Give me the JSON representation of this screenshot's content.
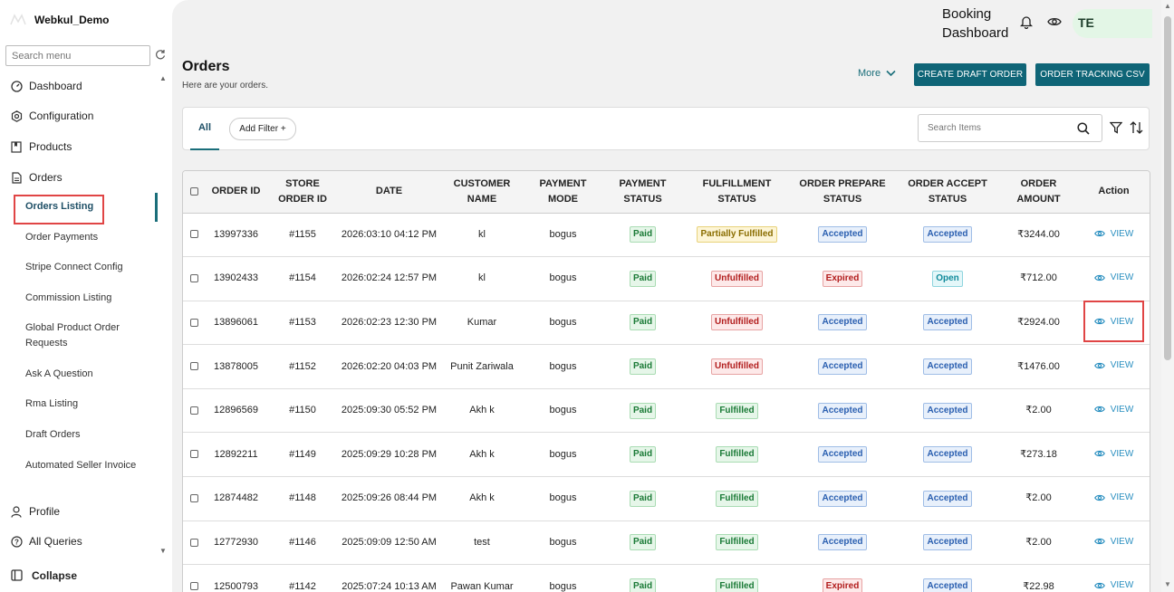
{
  "brand": {
    "name": "Webkul_Demo"
  },
  "sidebar": {
    "search_placeholder": "Search menu",
    "items": [
      {
        "label": "Dashboard",
        "icon": "dashboard-icon"
      },
      {
        "label": "Configuration",
        "icon": "settings-icon"
      },
      {
        "label": "Products",
        "icon": "bookmark-icon"
      },
      {
        "label": "Orders",
        "icon": "file-icon"
      }
    ],
    "subitems": [
      "Orders Listing",
      "Order Payments",
      "Stripe Connect Config",
      "Commission Listing",
      "Global Product Order Requests",
      "Ask A Question",
      "Rma Listing",
      "Draft Orders",
      "Automated Seller Invoice"
    ],
    "bottom_items": [
      {
        "label": "Profile",
        "icon": "user-icon"
      },
      {
        "label": "All Queries",
        "icon": "help-icon"
      }
    ],
    "collapse_label": "Collapse"
  },
  "topbar": {
    "title": "Booking Dashboard",
    "avatar_initials": "TE"
  },
  "page": {
    "title": "Orders",
    "subtitle": "Here are your orders.",
    "more_label": "More",
    "create_draft_label": "CREATE DRAFT ORDER",
    "tracking_csv_label": "ORDER TRACKING CSV"
  },
  "filters": {
    "tab_all": "All",
    "add_filter": "Add Filter +",
    "search_placeholder": "Search Items"
  },
  "table": {
    "headers": [
      "ORDER ID",
      "STORE ORDER ID",
      "DATE",
      "CUSTOMER NAME",
      "PAYMENT MODE",
      "PAYMENT STATUS",
      "FULFILLMENT STATUS",
      "ORDER PREPARE STATUS",
      "ORDER ACCEPT STATUS",
      "ORDER AMOUNT",
      "Action"
    ],
    "view_label": "VIEW",
    "rows": [
      {
        "order_id": "13997336",
        "store_id": "#1155",
        "date": "2026:03:10 04:12 PM",
        "customer": "kl",
        "mode": "bogus",
        "payment": "Paid",
        "fulfillment": "Partially Fulfilled",
        "prepare": "Accepted",
        "accept": "Accepted",
        "amount": "₹3244.00"
      },
      {
        "order_id": "13902433",
        "store_id": "#1154",
        "date": "2026:02:24 12:57 PM",
        "customer": "kl",
        "mode": "bogus",
        "payment": "Paid",
        "fulfillment": "Unfulfilled",
        "prepare": "Expired",
        "accept": "Open",
        "amount": "₹712.00"
      },
      {
        "order_id": "13896061",
        "store_id": "#1153",
        "date": "2026:02:23 12:30 PM",
        "customer": "Kumar",
        "mode": "bogus",
        "payment": "Paid",
        "fulfillment": "Unfulfilled",
        "prepare": "Accepted",
        "accept": "Accepted",
        "amount": "₹2924.00"
      },
      {
        "order_id": "13878005",
        "store_id": "#1152",
        "date": "2026:02:20 04:03 PM",
        "customer": "Punit Zariwala",
        "mode": "bogus",
        "payment": "Paid",
        "fulfillment": "Unfulfilled",
        "prepare": "Accepted",
        "accept": "Accepted",
        "amount": "₹1476.00"
      },
      {
        "order_id": "12896569",
        "store_id": "#1150",
        "date": "2025:09:30 05:52 PM",
        "customer": "Akh k",
        "mode": "bogus",
        "payment": "Paid",
        "fulfillment": "Fulfilled",
        "prepare": "Accepted",
        "accept": "Accepted",
        "amount": "₹2.00"
      },
      {
        "order_id": "12892211",
        "store_id": "#1149",
        "date": "2025:09:29 10:28 PM",
        "customer": "Akh k",
        "mode": "bogus",
        "payment": "Paid",
        "fulfillment": "Fulfilled",
        "prepare": "Accepted",
        "accept": "Accepted",
        "amount": "₹273.18"
      },
      {
        "order_id": "12874482",
        "store_id": "#1148",
        "date": "2025:09:26 08:44 PM",
        "customer": "Akh k",
        "mode": "bogus",
        "payment": "Paid",
        "fulfillment": "Fulfilled",
        "prepare": "Accepted",
        "accept": "Accepted",
        "amount": "₹2.00"
      },
      {
        "order_id": "12772930",
        "store_id": "#1146",
        "date": "2025:09:09 12:50 AM",
        "customer": "test",
        "mode": "bogus",
        "payment": "Paid",
        "fulfillment": "Fulfilled",
        "prepare": "Accepted",
        "accept": "Accepted",
        "amount": "₹2.00"
      },
      {
        "order_id": "12500793",
        "store_id": "#1142",
        "date": "2025:07:24 10:13 AM",
        "customer": "Pawan Kumar",
        "mode": "bogus",
        "payment": "Paid",
        "fulfillment": "Fulfilled",
        "prepare": "Expired",
        "accept": "Accepted",
        "amount": "₹22.98"
      }
    ]
  },
  "colors": {
    "primary": "#0f6577",
    "link": "#2a8fc0",
    "highlight": "#e04545"
  }
}
